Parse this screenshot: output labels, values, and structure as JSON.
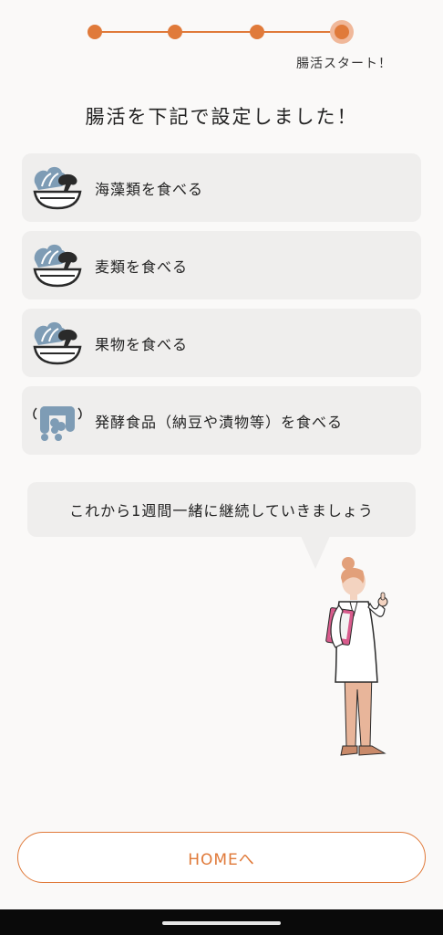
{
  "progress": {
    "current_step": 4,
    "total_steps": 4,
    "step_label": "腸活スタート！"
  },
  "title": "腸活を下記で設定しました！",
  "items": [
    {
      "label": "海藻類を食べる",
      "icon": "salad-bowl-icon"
    },
    {
      "label": "麦類を食べる",
      "icon": "salad-bowl-icon"
    },
    {
      "label": "果物を食べる",
      "icon": "salad-bowl-icon"
    },
    {
      "label": "発酵食品（納豆や漬物等）を食べる",
      "icon": "intestine-icon"
    }
  ],
  "speech_bubble": "これから1週間一緒に継続していきましょう",
  "home_button": "HOMEへ",
  "colors": {
    "accent": "#e07a3a",
    "card_bg": "#efeeed",
    "icon_blue": "#7e9cb5"
  }
}
